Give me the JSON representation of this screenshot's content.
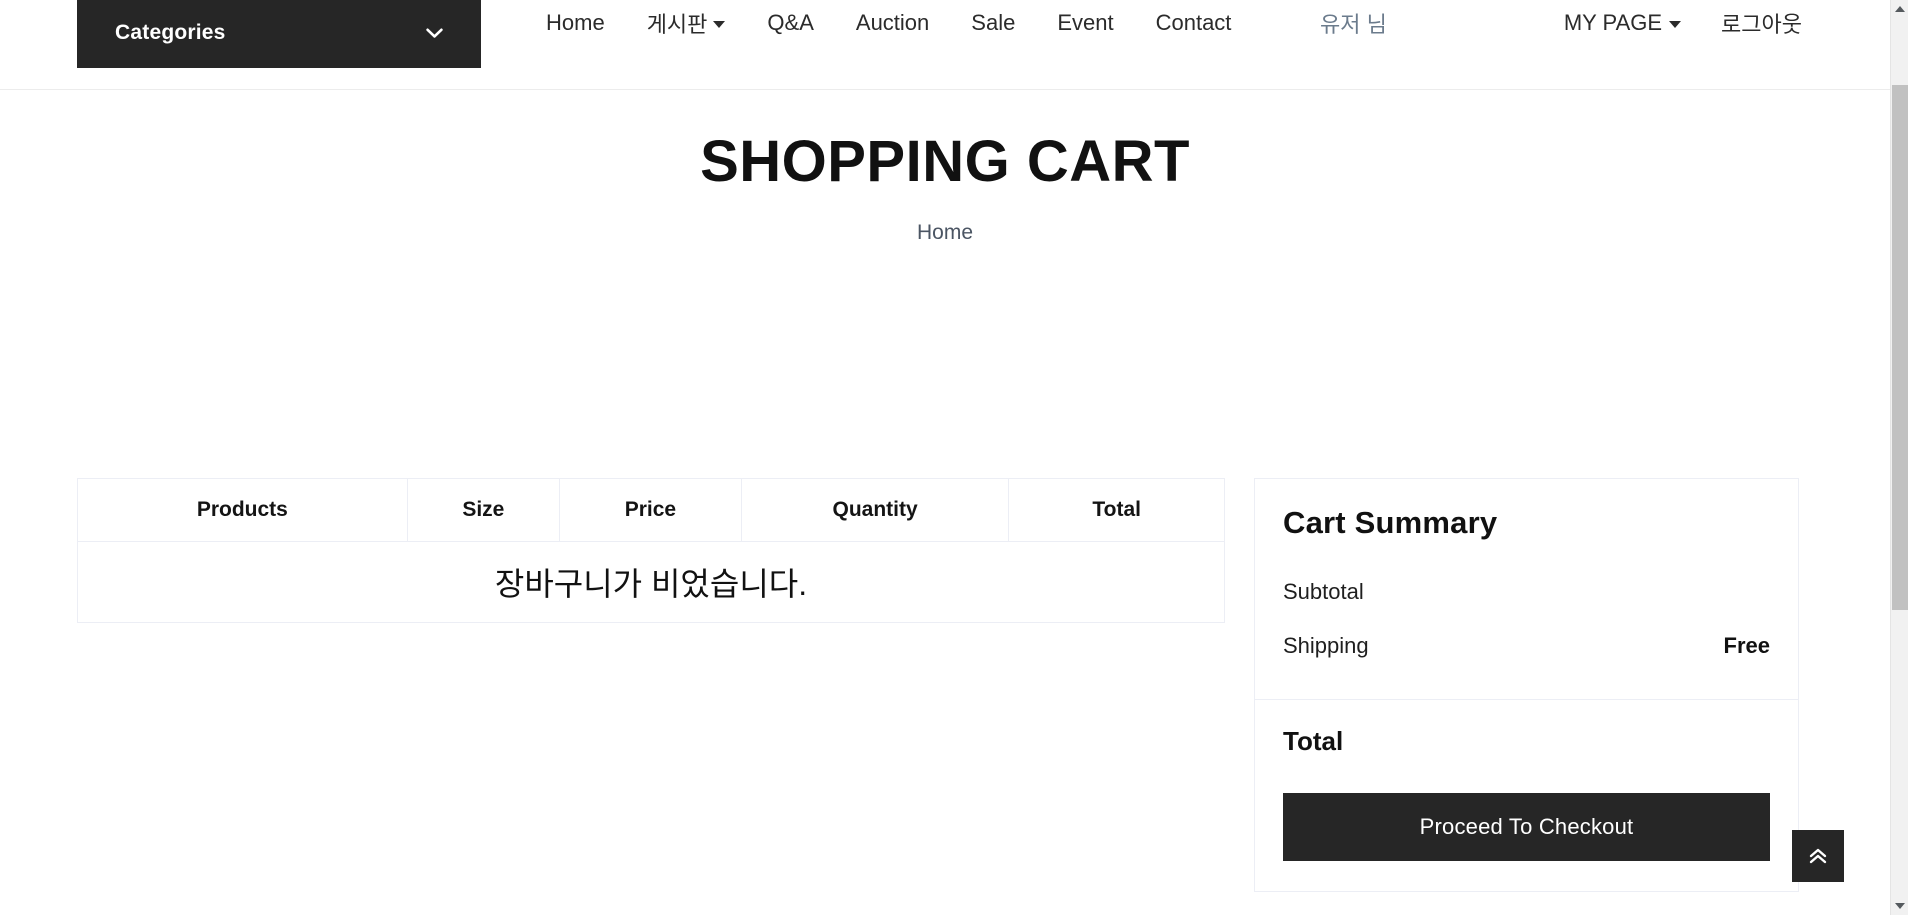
{
  "navbar": {
    "categories": {
      "label": "Categories",
      "caret_icon": "chevron-down-icon"
    },
    "menu": [
      {
        "label": "Home",
        "has_caret": false
      },
      {
        "label": "게시판",
        "has_caret": true
      },
      {
        "label": "Q&A",
        "has_caret": false
      },
      {
        "label": "Auction",
        "has_caret": false
      },
      {
        "label": "Sale",
        "has_caret": false
      },
      {
        "label": "Event",
        "has_caret": false
      },
      {
        "label": "Contact",
        "has_caret": false
      }
    ],
    "username": "유저 님",
    "account": [
      {
        "label": "MY PAGE",
        "has_caret": true
      },
      {
        "label": "로그아웃",
        "has_caret": false
      }
    ]
  },
  "page": {
    "title": "SHOPPING CART",
    "breadcrumb": "Home"
  },
  "cart_table": {
    "headers": [
      "Products",
      "Size",
      "Price",
      "Quantity",
      "Total"
    ],
    "empty_message": "장바구니가 비었습니다."
  },
  "cart_summary": {
    "title": "Cart Summary",
    "rows": [
      {
        "label": "Subtotal",
        "value": ""
      },
      {
        "label": "Shipping",
        "value": "Free"
      }
    ],
    "total_label": "Total",
    "total_value": "",
    "checkout_label": "Proceed To Checkout"
  },
  "back_to_top": {
    "icon": "double-chevron-up-icon"
  },
  "colors": {
    "dark": "#262626",
    "text": "#222222",
    "username": "#6b7b8c",
    "border": "#eceef5",
    "scrollbar_thumb": "#c1c1c1"
  }
}
